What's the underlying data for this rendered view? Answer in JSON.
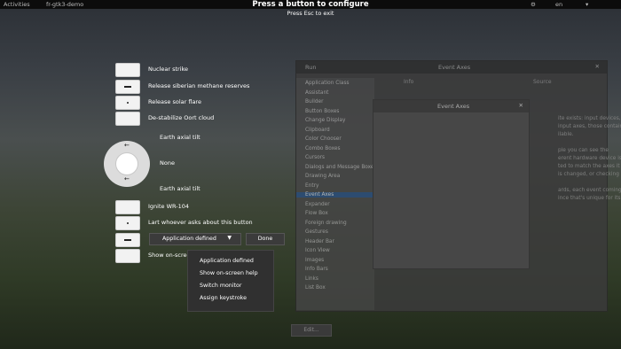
{
  "topbar": {
    "activities": "Activities",
    "app_name": "fr-gtk3-demo",
    "title": "Press a button to configure",
    "subtitle": "Press Esc to exit",
    "locale": "en"
  },
  "background_window": {
    "run_label": "Run",
    "title": "Event Axes",
    "tabs": [
      "Info",
      "Source"
    ],
    "list_items": [
      "Application Class",
      "Assistant",
      "Builder",
      "Button Boxes",
      "Change Display",
      "Clipboard",
      "Color Chooser",
      "Combo Boxes",
      "Cursors",
      "Dialogs and Message Boxes",
      "Drawing Area",
      "Entry",
      "Event Axes",
      "Expander",
      "Flow Box",
      "Foreign drawing",
      "Gestures",
      "Header Bar",
      "Icon View",
      "Images",
      "Info Bars",
      "Links",
      "List Box"
    ],
    "selected_index": 12,
    "text_lines": [
      "ite exists: input devices,",
      "input axes, those contain",
      "ilable.",
      "",
      "ple you can see the",
      "erent hardware device is",
      "ted to match the axes it",
      "is changed, or checking",
      "",
      "ards, each event coming",
      "ince that's unique for its"
    ],
    "edit_label": "Edit..."
  },
  "event_axes_dialog": {
    "title": "Event Axes"
  },
  "mapping": {
    "buttons": [
      {
        "label": "Nuclear strike",
        "mark": "none"
      },
      {
        "label": "Release siberian methane reserves",
        "mark": "line"
      },
      {
        "label": "Release solar flare",
        "mark": "dot"
      },
      {
        "label": "De-stabilize Oort cloud",
        "mark": "none"
      }
    ],
    "ring": {
      "up_label": "Earth axial tilt",
      "center_label": "None",
      "down_label": "Earth axial tilt"
    },
    "buttons2": [
      {
        "label": "Ignite WR-104",
        "mark": "none"
      },
      {
        "label": "Lart whoever asks about this button",
        "mark": "dot"
      }
    ],
    "combo_value": "Application defined",
    "done_label": "Done",
    "last_label": "Show on-scree"
  },
  "menu": {
    "items": [
      "Application defined",
      "Show on-screen help",
      "Switch monitor",
      "Assign keystroke"
    ]
  }
}
